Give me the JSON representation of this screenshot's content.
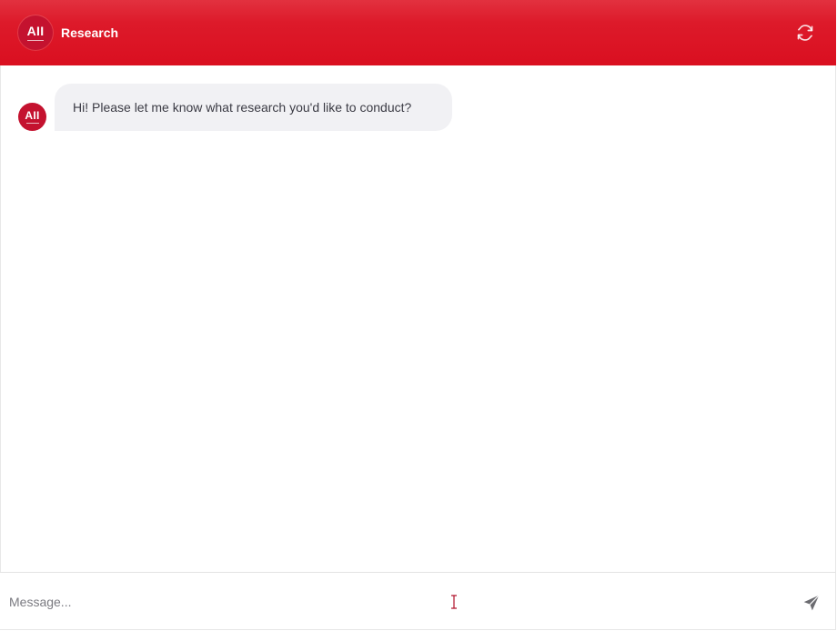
{
  "header": {
    "logo_text": "AII",
    "title": "Research",
    "refresh_icon": "refresh-icon"
  },
  "chat": {
    "messages": [
      {
        "role": "assistant",
        "avatar_text": "AII",
        "text": "Hi! Please let me know what research you'd like to conduct?"
      }
    ]
  },
  "composer": {
    "placeholder": "Message...",
    "value": "",
    "send_icon": "send-icon"
  },
  "colors": {
    "brand_red": "#da0f20",
    "avatar_red": "#c4122f",
    "bubble_bg": "#f1f1f4"
  }
}
